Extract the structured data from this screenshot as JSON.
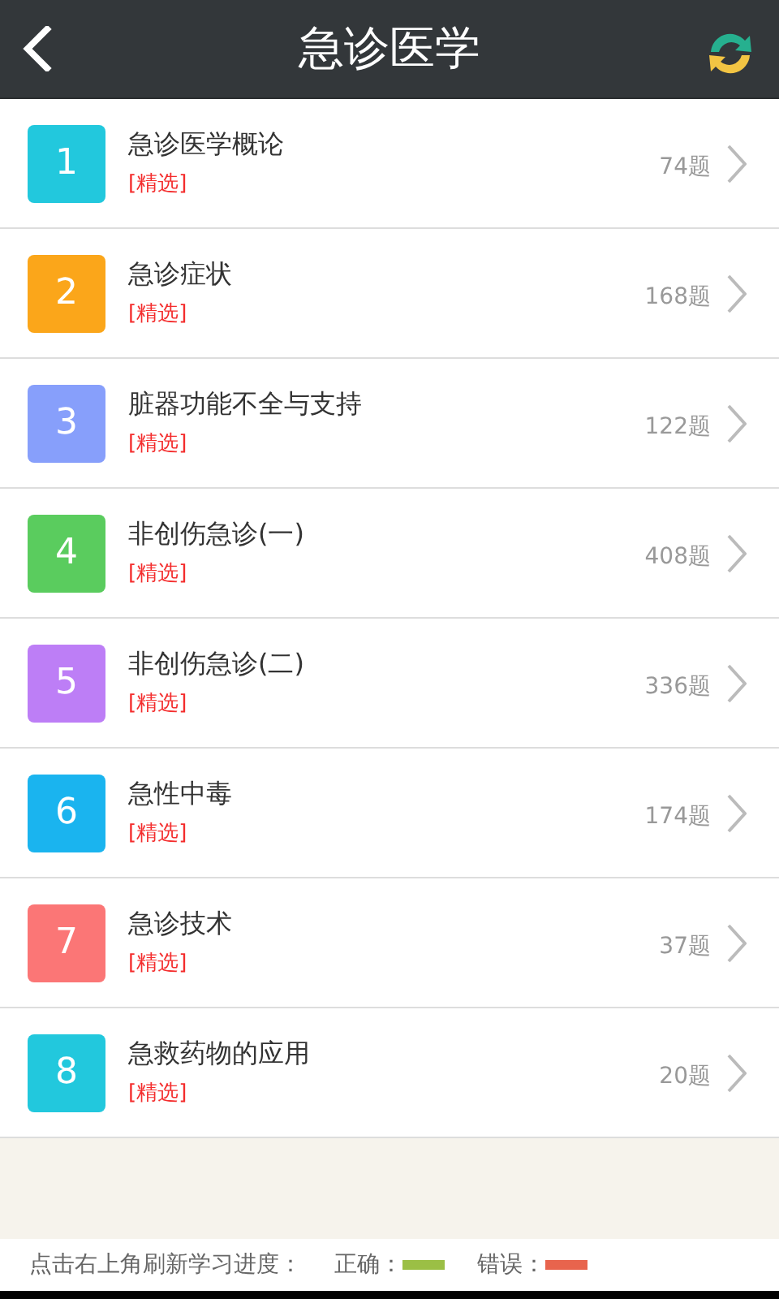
{
  "header": {
    "title": "急诊医学"
  },
  "chapters": [
    {
      "number": "1",
      "title": "急诊医学概论",
      "tag": "[精选]",
      "count": "74题",
      "color": "#22c8dd"
    },
    {
      "number": "2",
      "title": "急诊症状",
      "tag": "[精选]",
      "count": "168题",
      "color": "#fba61a"
    },
    {
      "number": "3",
      "title": "脏器功能不全与支持",
      "tag": "[精选]",
      "count": "122题",
      "color": "#879ffb"
    },
    {
      "number": "4",
      "title": "非创伤急诊(一)",
      "tag": "[精选]",
      "count": "408题",
      "color": "#5acc5e"
    },
    {
      "number": "5",
      "title": "非创伤急诊(二)",
      "tag": "[精选]",
      "count": "336题",
      "color": "#bd7ef6"
    },
    {
      "number": "6",
      "title": "急性中毒",
      "tag": "[精选]",
      "count": "174题",
      "color": "#1ab4ef"
    },
    {
      "number": "7",
      "title": "急诊技术",
      "tag": "[精选]",
      "count": "37题",
      "color": "#fb7676"
    },
    {
      "number": "8",
      "title": "急救药物的应用",
      "tag": "[精选]",
      "count": "20题",
      "color": "#22c8dd"
    }
  ],
  "footer": {
    "hint": "点击右上角刷新学习进度：",
    "legend": [
      {
        "label": "正确：",
        "color": "#9bbf45"
      },
      {
        "label": "错误：",
        "color": "#e8644d"
      }
    ]
  }
}
